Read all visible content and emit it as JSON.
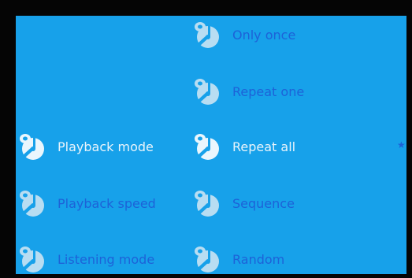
{
  "left_menu": {
    "items": [
      {
        "label": "Playback mode",
        "icon": "music-disc-icon",
        "state": "selected"
      },
      {
        "label": "Playback speed",
        "icon": "music-disc-icon",
        "state": "normal"
      },
      {
        "label": "Listening mode",
        "icon": "music-disc-icon",
        "state": "normal"
      }
    ]
  },
  "submenu": {
    "items": [
      {
        "label": "Only once",
        "icon": "music-disc-icon",
        "state": "normal"
      },
      {
        "label": "Repeat one",
        "icon": "music-disc-icon",
        "state": "normal"
      },
      {
        "label": "Repeat all",
        "icon": "music-disc-icon",
        "state": "selected"
      },
      {
        "label": "Sequence",
        "icon": "music-disc-icon",
        "state": "normal"
      },
      {
        "label": "Random",
        "icon": "music-disc-icon",
        "state": "normal"
      }
    ],
    "current_marker": "★"
  },
  "colors": {
    "screen_bg": "#17a1ea",
    "bezel": "#050505",
    "text_normal": "#1d62d8",
    "text_selected": "#e9f4fb"
  }
}
